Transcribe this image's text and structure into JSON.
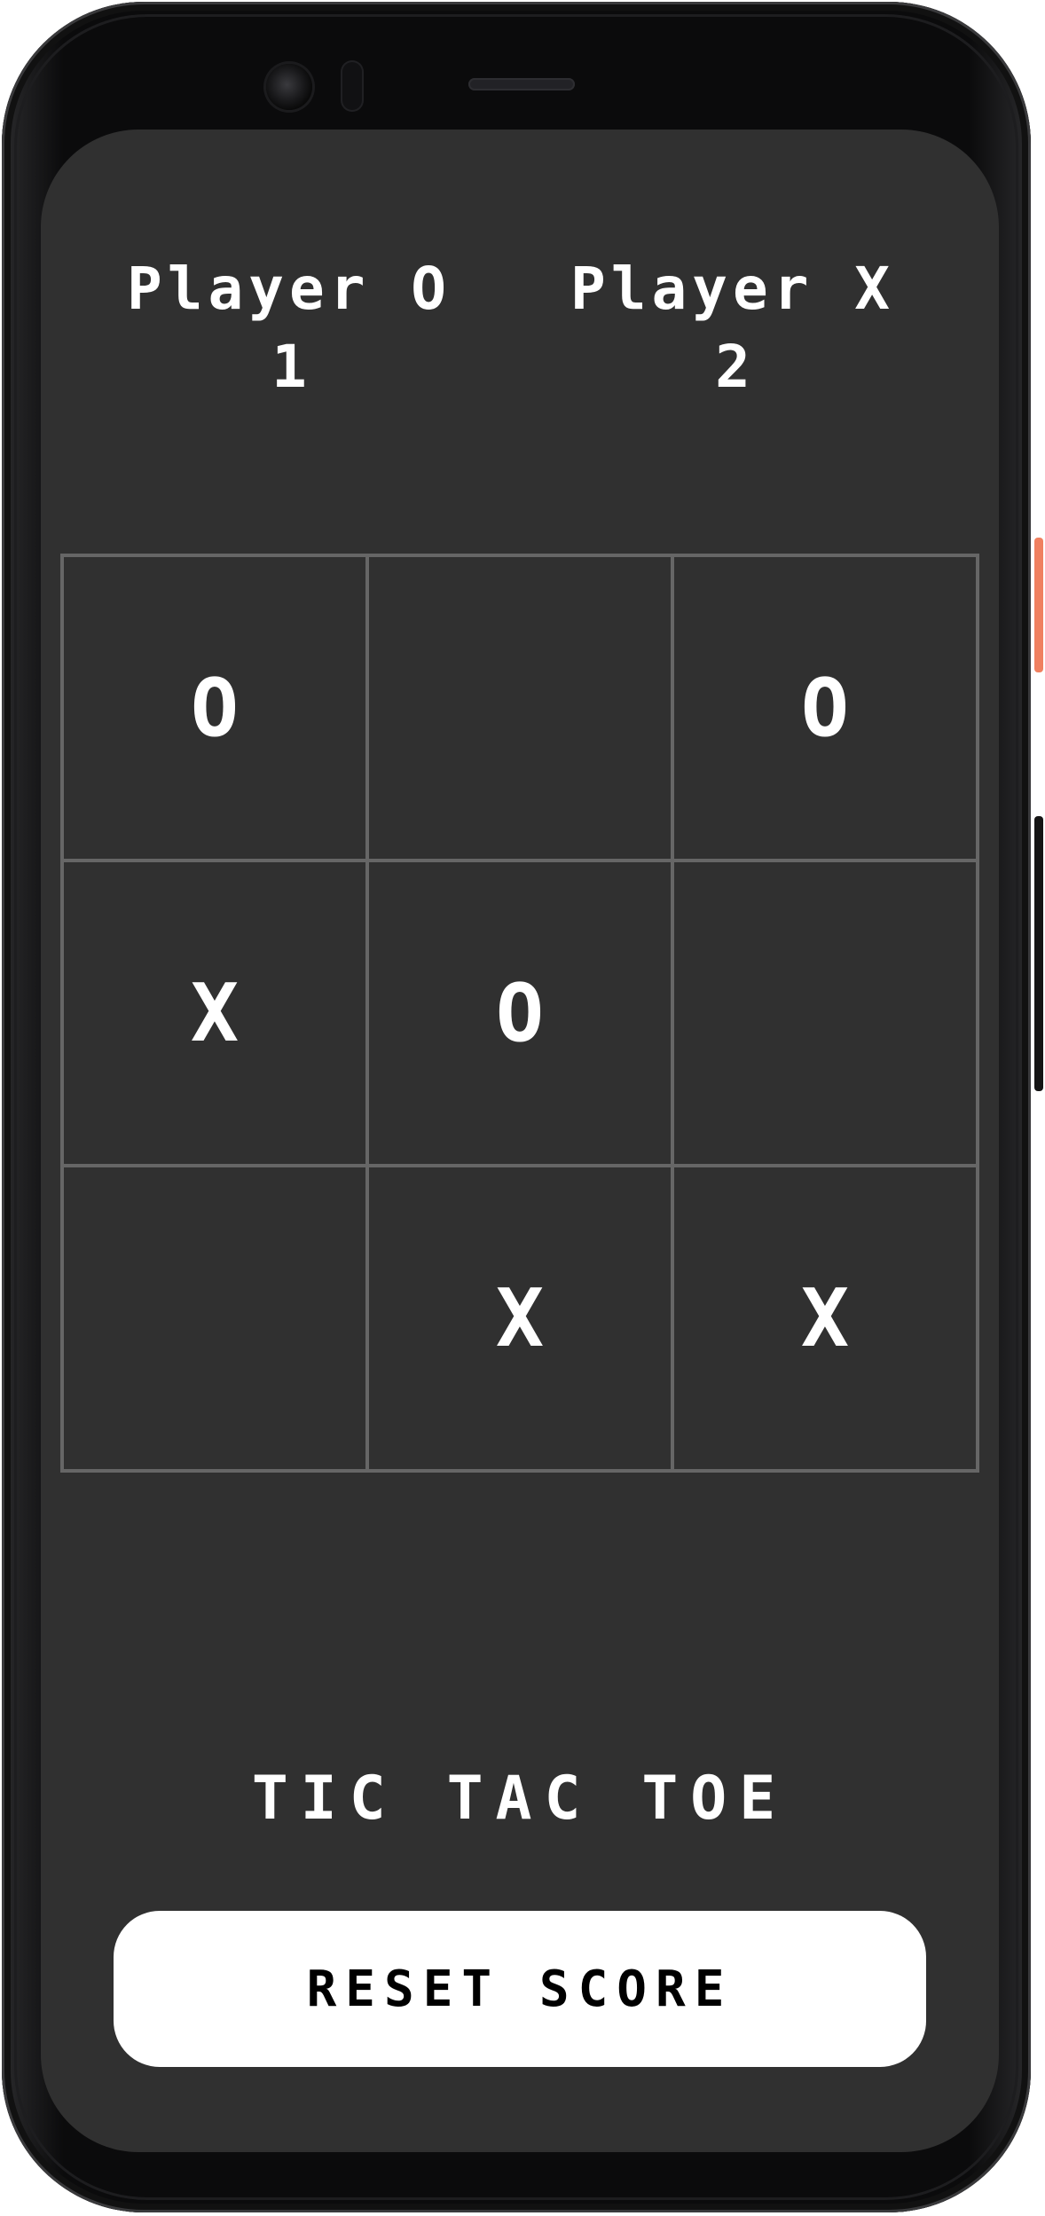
{
  "score": {
    "player_o": {
      "label": "Player O",
      "score": "1"
    },
    "player_x": {
      "label": "Player X",
      "score": "2"
    }
  },
  "board": {
    "cells": [
      "O",
      "",
      "O",
      "X",
      "O",
      "",
      "",
      "X",
      "X"
    ]
  },
  "title": "TIC TAC TOE",
  "reset_button": {
    "label": "RESET SCORE"
  },
  "colors": {
    "background": "#303030",
    "grid_line": "#666666",
    "text": "#ffffff",
    "button_bg": "#ffffff",
    "button_text": "#000000"
  }
}
